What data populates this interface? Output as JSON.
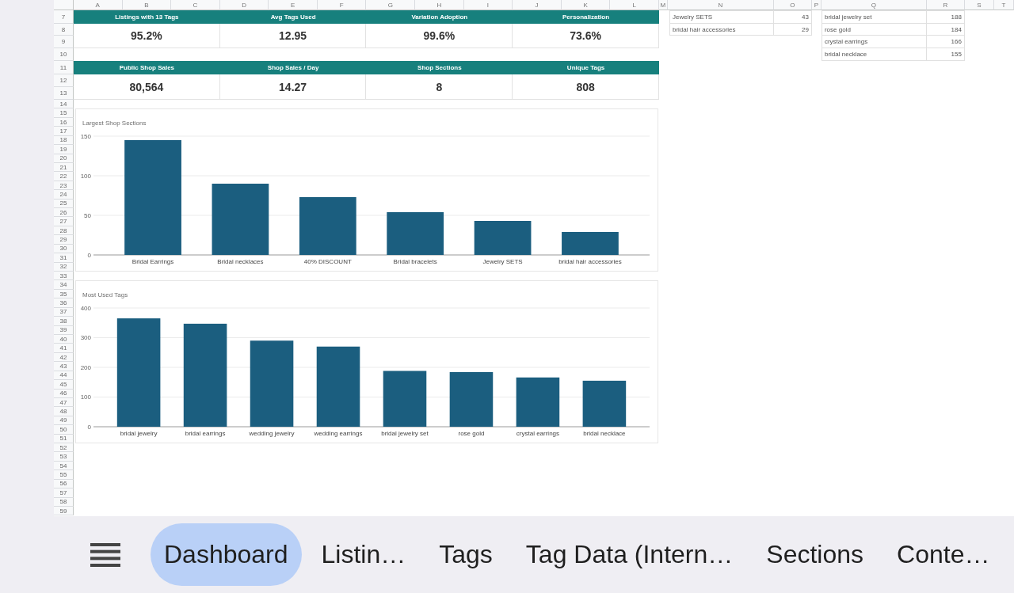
{
  "sheet": {
    "column_headers": [
      "A",
      "B",
      "C",
      "D",
      "E",
      "F",
      "G",
      "H",
      "I",
      "J",
      "K",
      "L",
      "M",
      "N",
      "O",
      "P",
      "Q",
      "R",
      "S",
      "T"
    ],
    "row_numbers": [
      "7",
      "8",
      "9",
      "10",
      "11",
      "12",
      "13",
      "14",
      "15",
      "16",
      "17",
      "18",
      "19",
      "20",
      "21",
      "22",
      "23",
      "24",
      "25",
      "26",
      "27",
      "28",
      "29",
      "30",
      "31",
      "32",
      "33",
      "34",
      "35",
      "36",
      "37",
      "38",
      "39",
      "40",
      "41",
      "42",
      "43",
      "44",
      "45",
      "46",
      "47",
      "48",
      "49",
      "50",
      "51",
      "52",
      "53",
      "54",
      "55",
      "56",
      "57",
      "58",
      "59"
    ]
  },
  "kpi_rows": [
    {
      "cells": [
        {
          "label": "Listings with 13 Tags",
          "value": "95.2%"
        },
        {
          "label": "Avg Tags Used",
          "value": "12.95"
        },
        {
          "label": "Variation Adoption",
          "value": "99.6%"
        },
        {
          "label": "Personalization",
          "value": "73.6%"
        }
      ]
    },
    {
      "cells": [
        {
          "label": "Public Shop Sales",
          "value": "80,564"
        },
        {
          "label": "Shop Sales / Day",
          "value": "14.27"
        },
        {
          "label": "Shop Sections",
          "value": "8"
        },
        {
          "label": "Unique Tags",
          "value": "808"
        }
      ]
    }
  ],
  "section_counts": [
    {
      "name": "Jewelry SETS",
      "count": "43"
    },
    {
      "name": "bridal hair accessories",
      "count": "29"
    }
  ],
  "tag_counts": [
    {
      "name": "bridal jewelry set",
      "count": "188"
    },
    {
      "name": "rose gold",
      "count": "184"
    },
    {
      "name": "crystal earrings",
      "count": "166"
    },
    {
      "name": "bridal necklace",
      "count": "155"
    }
  ],
  "charts": [
    {
      "chart_data": {
        "type": "bar",
        "title": "Largest Shop Sections",
        "categories": [
          "Bridal Earrings",
          "Bridal necklaces",
          "40% DISCOUNT",
          "Bridal bracelets",
          "Jewelry SETS",
          "bridal hair accessories"
        ],
        "values": [
          145,
          90,
          73,
          54,
          43,
          29
        ],
        "ylim": [
          0,
          150
        ],
        "yticks": [
          0,
          50,
          100,
          150
        ],
        "grid": true
      }
    },
    {
      "chart_data": {
        "type": "bar",
        "title": "Most Used Tags",
        "categories": [
          "bridal jewelry",
          "bridal earrings",
          "wedding jewelry",
          "wedding earrings",
          "bridal jewelry set",
          "rose gold",
          "crystal earrings",
          "bridal necklace"
        ],
        "values": [
          365,
          347,
          290,
          270,
          188,
          184,
          166,
          155
        ],
        "ylim": [
          0,
          400
        ],
        "yticks": [
          0,
          100,
          200,
          300,
          400
        ],
        "grid": true
      }
    }
  ],
  "sheet_tabs": [
    {
      "label": "Dashboard",
      "selected": true
    },
    {
      "label": "Listin…",
      "selected": false
    },
    {
      "label": "Tags",
      "selected": false
    },
    {
      "label": "Tag Data (Intern…",
      "selected": false
    },
    {
      "label": "Sections",
      "selected": false
    },
    {
      "label": "Conte…",
      "selected": false
    }
  ]
}
